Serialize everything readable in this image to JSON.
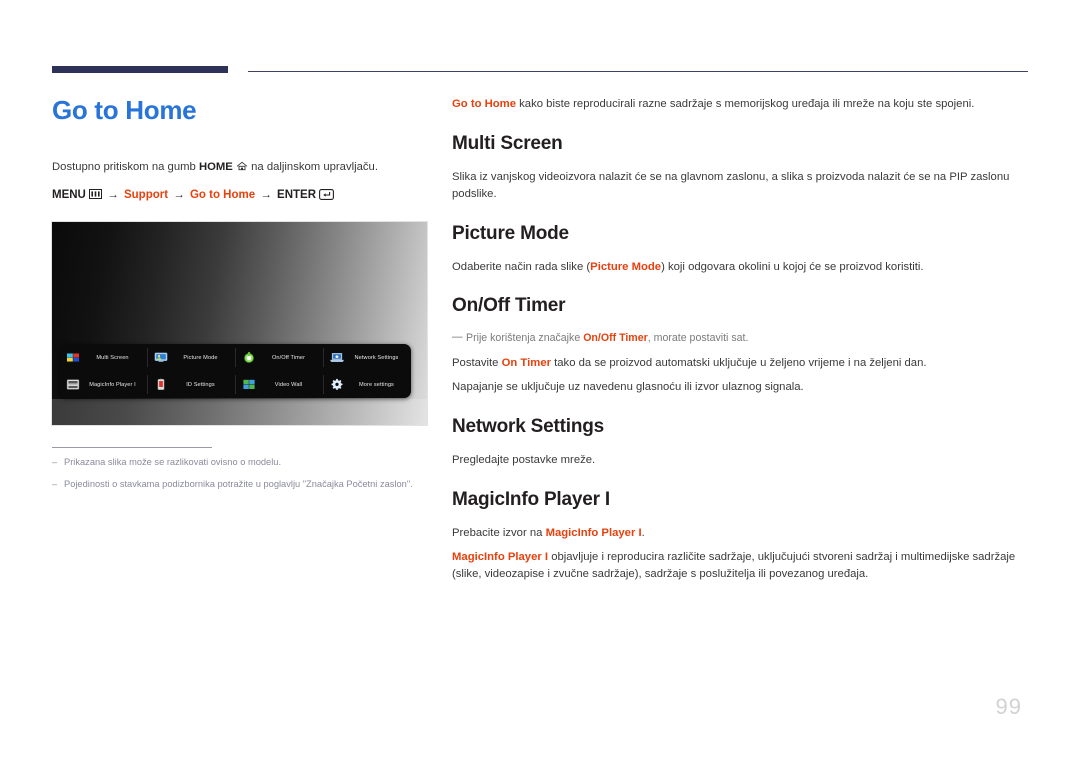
{
  "header": {
    "accent_color": "#2e3158",
    "rule_color": "#3f4266"
  },
  "left": {
    "page_title": "Go to Home",
    "title_color": "#2874d8",
    "intro_prefix": "Dostupno pritiskom na gumb ",
    "intro_bold": "HOME",
    "intro_suffix": " na daljinskom upravljaču.",
    "menu_path": {
      "menu_label": "MENU",
      "arrow": "→",
      "support_label": "Support",
      "go_to_home_label": "Go to Home",
      "enter_label": "ENTER"
    },
    "osd": {
      "items": [
        {
          "label": "Multi Screen",
          "icon": "multi-screen-icon"
        },
        {
          "label": "Picture Mode",
          "icon": "picture-mode-icon"
        },
        {
          "label": "On/Off Timer",
          "icon": "on-off-timer-icon"
        },
        {
          "label": "Network Settings",
          "icon": "network-settings-icon"
        },
        {
          "label": "MagicInfo Player I",
          "icon": "magicinfo-player-icon"
        },
        {
          "label": "ID Settings",
          "icon": "id-settings-icon"
        },
        {
          "label": "Video Wall",
          "icon": "video-wall-icon"
        },
        {
          "label": "More settings",
          "icon": "more-settings-icon"
        }
      ]
    },
    "footnotes": [
      {
        "dash": "–",
        "text": "Prikazana slika može se razlikovati ovisno o modelu."
      },
      {
        "dash": "–",
        "text": "Pojedinosti o stavkama podizbornika potražite u poglavlju \"Značajka Početni zaslon\"."
      }
    ]
  },
  "right": {
    "intro": {
      "red_bold": "Go to Home",
      "rest": " kako biste reproducirali razne sadržaje s memorijskog uređaja ili mreže na koju ste spojeni."
    },
    "sections": [
      {
        "heading": "Multi Screen",
        "body": "Slika iz vanjskog videoizvora nalazit će se na glavnom zaslonu, a slika s proizvoda nalazit će se na PIP zaslonu podslike."
      },
      {
        "heading": "Picture Mode",
        "body_pre": "Odaberite način rada slike (",
        "body_red": "Picture Mode",
        "body_post": ") koji odgovara okolini u kojoj će se proizvod koristiti."
      },
      {
        "heading": "On/Off Timer",
        "note_dash": "—",
        "note_pre": "Prije korištenja značajke ",
        "note_red": "On/Off Timer",
        "note_post": ", morate postaviti sat.",
        "line2_pre": "Postavite ",
        "line2_red": "On Timer",
        "line2_post": " tako da se proizvod automatski uključuje u željeno vrijeme i na željeni dan.",
        "line3": "Napajanje se uključuje uz navedenu glasnoću ili izvor ulaznog signala."
      },
      {
        "heading": "Network Settings",
        "body": "Pregledajte postavke mreže."
      },
      {
        "heading": "MagicInfo Player I",
        "line1_pre": "Prebacite izvor na ",
        "line1_red": "MagicInfo Player I",
        "line1_post": ".",
        "line2_red": "MagicInfo Player I",
        "line2_post": " objavljuje i reproducira različite sadržaje, uključujući stvoreni sadržaj i multimedijske sadržaje (slike, videozapise i zvučne sadržaje), sadržaje s poslužitelja ili povezanog uređaja."
      }
    ]
  },
  "page_number": "99",
  "colors": {
    "accent_red": "#e8410e",
    "title_blue": "#2874d8",
    "navy": "#2e3158"
  }
}
